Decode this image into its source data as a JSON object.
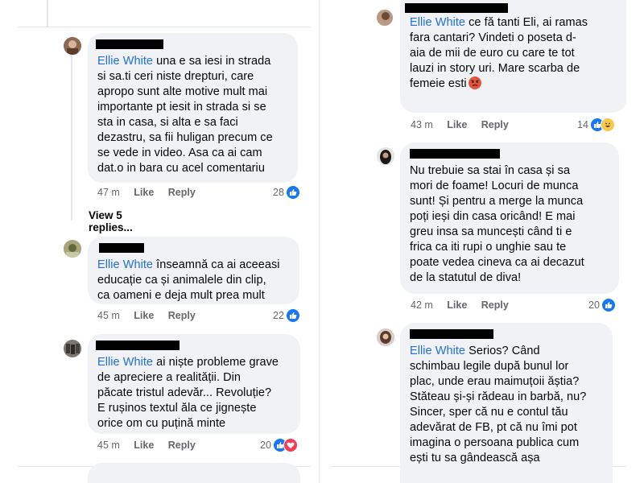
{
  "left": {
    "c1": {
      "mention": "Ellie White",
      "text": " una e sa iesi in strada\nsi sa.ti ceri niste drepturi, care\napropo sunt alte motive mult mai\nimportante pt iesit in strada si se\nsta in casa, si alta e sa faci\ndezastru, sa fii huligan precum ce\nse vede in video. Asa ca ai cam\ndat.o in bara cu acel comentariu",
      "time": "47 m",
      "like": "Like",
      "reply": "Reply",
      "count": "28",
      "view_replies": "View 5 replies..."
    },
    "c2": {
      "mention": "Ellie White",
      "text": " înseamnă ca ai aceeasi\neducație ca și animalele din clip,\nca oameni e deja mult prea mult",
      "time": "45 m",
      "like": "Like",
      "reply": "Reply",
      "count": "22"
    },
    "c3": {
      "mention": "Ellie White",
      "text": " ai niște probleme grave\nde apreciere a realității. Din\npăcate tristul adevăr... Revoluție?\nE rușinos textul ăla ce jignește\norice om cu puțină minte",
      "time": "45 m",
      "like": "Like",
      "reply": "Reply",
      "count": "20"
    }
  },
  "right": {
    "c1": {
      "mention": "Ellie White",
      "text": " ce fă tanti Eli, ai ramas\nfara cantari? Vindeti o poseta d-\naia de mii de euro cu care te tot\nlauzi in story uri. Mare scarba de\nfemeie esti",
      "time": "43 m",
      "like": "Like",
      "reply": "Reply",
      "count": "14"
    },
    "c2": {
      "text": "Nu trebuie sa stai în casa și sa\nmori de foame! Locuri de munca\nsunt! Și pentru a merge la munca\npoți ieși din casa oricând! E mai\ngreu insa sa muncești când ti e\nfrica ca iti rupi o unghie sau te\npoate vedea cineva ca ai decazut\nde la statutul de diva!",
      "time": "42 m",
      "like": "Like",
      "reply": "Reply",
      "count": "20"
    },
    "c3": {
      "mention": "Ellie White",
      "text": " Serios? Când\nschimbau legile după bunul lor\nplac, unde erau maimuțoii ăștia?\nStăteau și-și rădeau in barbă, nu?\nSincer, sper că nu e contul tău\nadevărat de FB, pt că nu îmi pot\nimagina o persoana publica cum\nești tu sa gândească așa"
    }
  }
}
